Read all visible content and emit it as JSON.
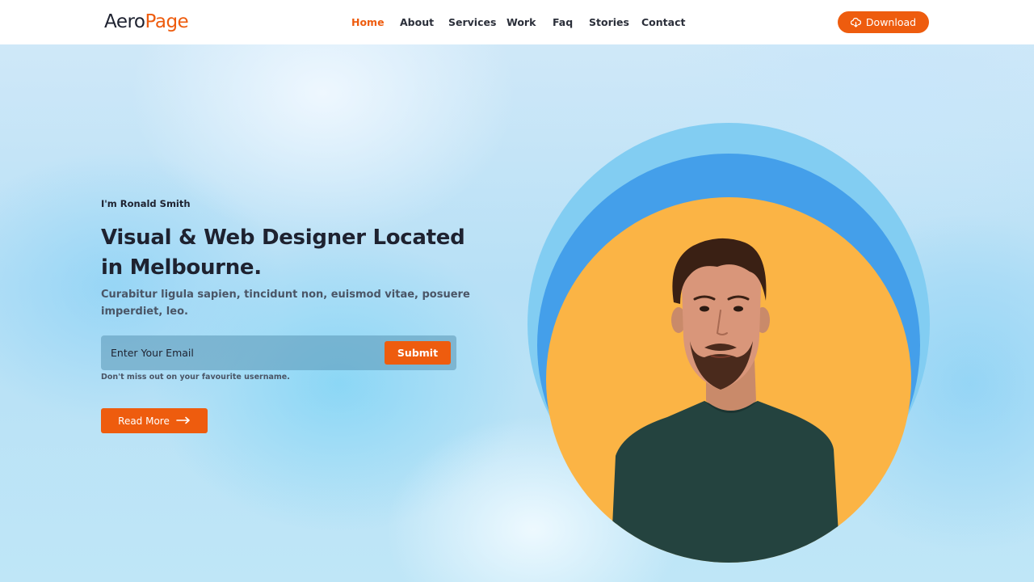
{
  "brand": {
    "part1": "Aero",
    "part2": "Page"
  },
  "nav": {
    "items": [
      {
        "label": "Home",
        "active": true
      },
      {
        "label": "About"
      },
      {
        "label": "Services"
      },
      {
        "label": "Work"
      },
      {
        "label": "Faq"
      },
      {
        "label": "Stories"
      },
      {
        "label": "Contact"
      }
    ],
    "download_label": "Download"
  },
  "hero": {
    "intro": "I'm Ronald Smith",
    "headline": "Visual & Web Designer Located in Melbourne.",
    "subtext": "Curabitur ligula sapien, tincidunt non, euismod vitae, posuere imperdiet, leo.",
    "email_placeholder": "Enter Your Email",
    "submit_label": "Submit",
    "hint": "Don't miss out on your favourite username.",
    "readmore_label": "Read More"
  },
  "colors": {
    "accent": "#ee5c0e",
    "text_dark": "#1e2230",
    "circle_outer": "#82cdf2",
    "circle_middle": "#449fea",
    "circle_inner": "#fbb445"
  }
}
